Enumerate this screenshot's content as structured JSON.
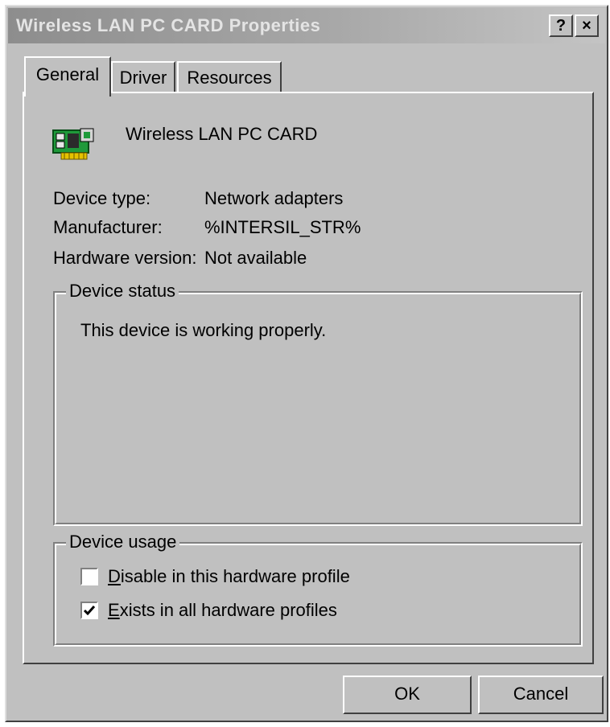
{
  "window": {
    "title": "Wireless LAN PC CARD Properties",
    "help_label": "?",
    "close_label": "×"
  },
  "tabs": [
    {
      "label": "General",
      "active": true
    },
    {
      "label": "Driver",
      "active": false
    },
    {
      "label": "Resources",
      "active": false
    }
  ],
  "device": {
    "icon": "network-card-icon",
    "name": "Wireless LAN PC CARD"
  },
  "properties": [
    {
      "label": "Device type:",
      "value": "Network adapters"
    },
    {
      "label": "Manufacturer:",
      "value": "%INTERSIL_STR%"
    },
    {
      "label": "Hardware version:",
      "value": "Not available"
    }
  ],
  "device_status": {
    "legend": "Device status",
    "text": "This device is working properly."
  },
  "device_usage": {
    "legend": "Device usage",
    "options": [
      {
        "label_first": "D",
        "label_rest": "isable in this hardware profile",
        "checked": false
      },
      {
        "label_first": "E",
        "label_rest": "xists in all hardware profiles",
        "checked": true
      }
    ]
  },
  "buttons": {
    "ok_label": "OK",
    "cancel_label": "Cancel"
  }
}
